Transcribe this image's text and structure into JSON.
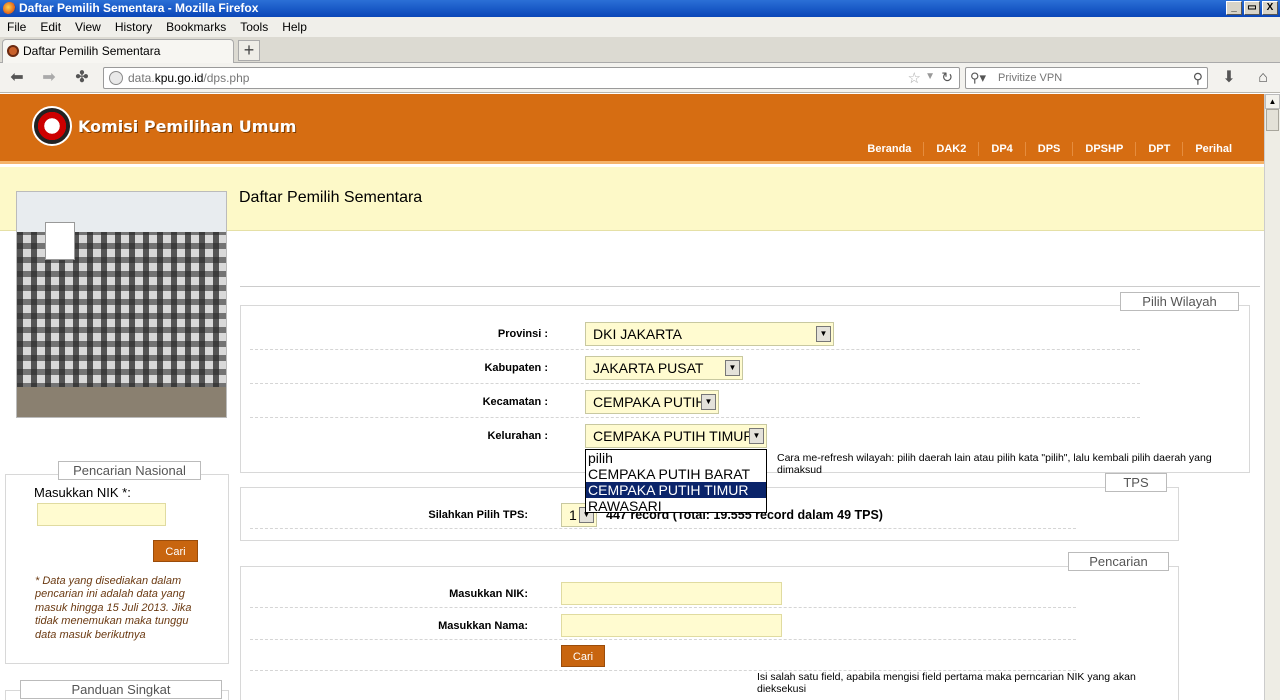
{
  "window": {
    "title": "Daftar Pemilih Sementara - Mozilla Firefox",
    "buttons": [
      "_",
      "▭",
      "X"
    ]
  },
  "menubar": {
    "items": [
      "File",
      "Edit",
      "View",
      "History",
      "Bookmarks",
      "Tools",
      "Help"
    ]
  },
  "tab": {
    "label": "Daftar Pemilih Sementara",
    "new_tab": "+"
  },
  "nav": {
    "url_prefix": "data.",
    "url_domain": "kpu.go.id",
    "url_path": "/dps.php",
    "search_placeholder": "Privitize VPN"
  },
  "site": {
    "title": "Komisi Pemilihan Umum",
    "nav": [
      "Beranda",
      "DAK2",
      "DP4",
      "DPS",
      "DPSHP",
      "DPT",
      "Perihal"
    ],
    "page_title": "Daftar Pemilih Sementara"
  },
  "wilayah": {
    "legend": "Pilih Wilayah",
    "provinsi_label": "Provinsi :",
    "provinsi_value": "DKI JAKARTA",
    "kabupaten_label": "Kabupaten :",
    "kabupaten_value": "JAKARTA PUSAT",
    "kecamatan_label": "Kecamatan :",
    "kecamatan_value": "CEMPAKA PUTIH",
    "kelurahan_label": "Kelurahan :",
    "kelurahan_value": "CEMPAKA PUTIH TIMUR",
    "options": [
      "pilih",
      "CEMPAKA PUTIH BARAT",
      "CEMPAKA PUTIH TIMUR",
      "RAWASARI"
    ],
    "refresh_note": "Cara me-refresh wilayah: pilih daerah lain atau pilih kata \"pilih\", lalu kembali pilih daerah yang dimaksud"
  },
  "tps": {
    "legend": "TPS",
    "label": "Silahkan Pilih TPS:",
    "value": "1",
    "record_text": "447 record (Total: 19.555 record dalam 49 TPS)"
  },
  "pencarian": {
    "legend": "Pencarian",
    "nik_label": "Masukkan NIK:",
    "nama_label": "Masukkan Nama:",
    "button": "Cari",
    "note": "Isi salah satu field, apabila mengisi field pertama maka perncarian NIK yang akan dieksekusi"
  },
  "nasional": {
    "legend": "Pencarian Nasional",
    "nik_label": "Masukkan NIK *:",
    "button": "Cari",
    "note": "* Data yang disediakan dalam pencarian ini adalah data yang masuk hingga 15 Juli 2013. Jika tidak menemukan maka tunggu data masuk berikutnya"
  },
  "panduan": {
    "legend": "Panduan Singkat"
  }
}
